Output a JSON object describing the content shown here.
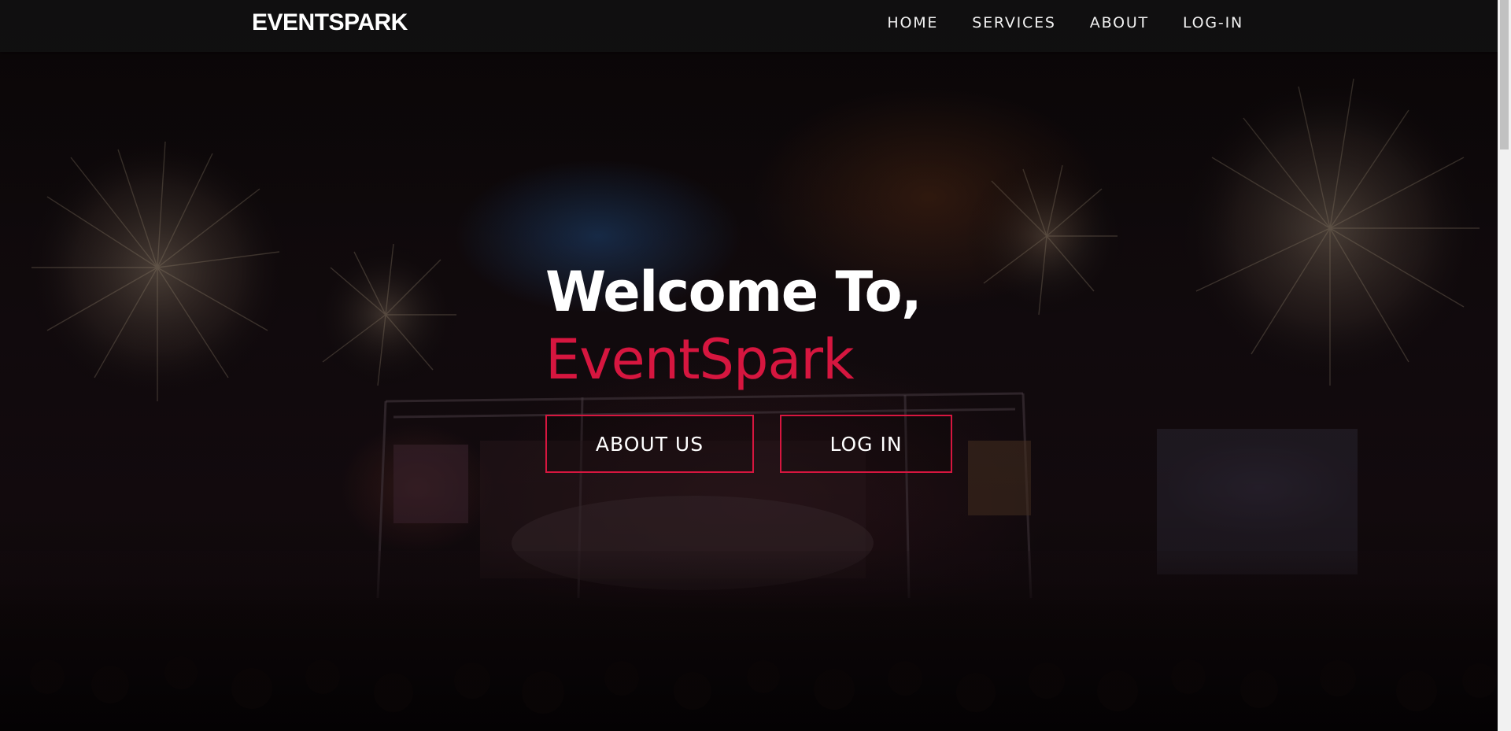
{
  "navbar": {
    "brand": "EVENTSPARK",
    "links": [
      {
        "label": "HOME"
      },
      {
        "label": "SERVICES"
      },
      {
        "label": "ABOUT"
      },
      {
        "label": "LOG-IN"
      }
    ]
  },
  "hero": {
    "title": "Welcome To,",
    "subtitle": "EventSpark",
    "buttons": {
      "about_label": "ABOUT US",
      "login_label": "LOG IN"
    },
    "background": "fireworks-concert-stage-image"
  },
  "colors": {
    "accent": "#d6163f",
    "navbar": "#121212",
    "text": "#ffffff"
  },
  "scroll": {
    "position": 0
  }
}
